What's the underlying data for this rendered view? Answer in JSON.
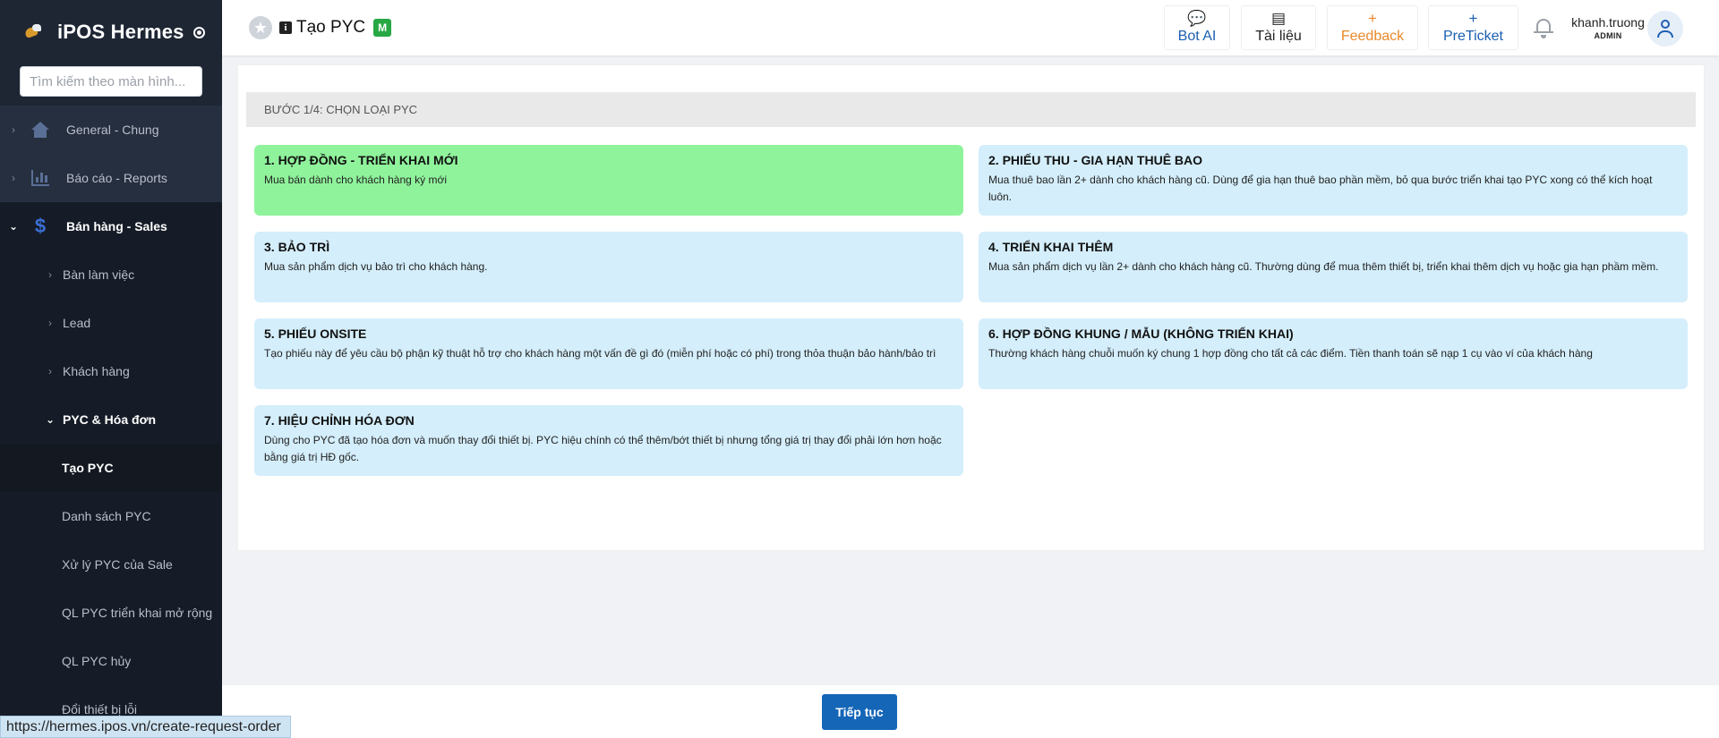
{
  "sidebar": {
    "brand": "iPOS Hermes",
    "search_placeholder": "Tìm kiếm theo màn hình...",
    "items": [
      {
        "label": "General - Chung",
        "icon": "home-icon"
      },
      {
        "label": "Báo cáo - Reports",
        "icon": "bar-chart-icon"
      },
      {
        "label": "Bán hàng - Sales",
        "icon": "dollar-icon"
      }
    ],
    "sub_items": [
      {
        "label": "Bàn làm việc"
      },
      {
        "label": "Lead"
      },
      {
        "label": "Khách hàng"
      },
      {
        "label": "PYC & Hóa đơn"
      }
    ],
    "sub_sub_items": [
      {
        "label": "Tạo PYC"
      },
      {
        "label": "Danh sách PYC"
      },
      {
        "label": "Xử lý PYC của Sale"
      },
      {
        "label": "QL PYC triển khai mở rộng"
      },
      {
        "label": "QL PYC hủy"
      },
      {
        "label": "Đổi thiết bị lỗi"
      }
    ]
  },
  "header": {
    "title": "Tạo PYC",
    "badge": "M",
    "buttons": [
      {
        "label": "Bot AI",
        "icon": "chat-icon",
        "color": "#1a5fb0"
      },
      {
        "label": "Tài liệu",
        "icon": "book-icon",
        "color": "#222222"
      },
      {
        "label": "Feedback",
        "icon": "plus-icon",
        "color": "#e8892a"
      },
      {
        "label": "PreTicket",
        "icon": "plus-icon",
        "color": "#1a5fb0"
      }
    ],
    "user": {
      "name": "khanh.truong",
      "role": "ADMIN"
    }
  },
  "main": {
    "step": "BƯỚC 1/4: CHỌN LOẠI PYC",
    "options": [
      {
        "title": "1. HỢP ĐỒNG - TRIỂN KHAI MỚI",
        "desc": "Mua bán dành cho khách hàng ký mới",
        "selected": true
      },
      {
        "title": "2. PHIẾU THU - GIA HẠN THUÊ BAO",
        "desc": "Mua thuê bao lần 2+ dành cho khách hàng cũ. Dùng để gia hạn thuê bao phần mềm, bỏ qua bước triển khai tạo PYC xong có thể kích hoạt luôn.",
        "selected": false
      },
      {
        "title": "3. BẢO TRÌ",
        "desc": "Mua sản phẩm dịch vụ bảo trì cho khách hàng.",
        "selected": false
      },
      {
        "title": "4. TRIỂN KHAI THÊM",
        "desc": "Mua sản phẩm dịch vụ lần 2+ dành cho khách hàng cũ. Thường dùng để mua thêm thiết bị, triển khai thêm dịch vụ hoặc gia hạn phầm mềm.",
        "selected": false
      },
      {
        "title": "5. PHIẾU ONSITE",
        "desc": "Tạo phiếu này để yêu cầu bộ phận kỹ thuật hỗ trợ cho khách hàng một vấn đề gì đó (miễn phí hoặc có phí) trong thỏa thuận bảo hành/bảo trì",
        "selected": false
      },
      {
        "title": "6. HỢP ĐỒNG KHUNG / MẪU (KHÔNG TRIỂN KHAI)",
        "desc": "Thường khách hàng chuỗi muốn ký chung 1 hợp đồng cho tất cả các điểm. Tiền thanh toán sẽ nạp 1 cụ vào ví của khách hàng",
        "selected": false
      },
      {
        "title": "7. HIỆU CHỈNH HÓA ĐƠN",
        "desc": "Dùng cho PYC đã tạo hóa đơn và muốn thay đổi thiết bị. PYC hiệu chính có thể thêm/bớt thiết bị nhưng tổng giá trị thay đổi phải lớn hơn hoặc bằng giá trị HĐ gốc.",
        "selected": false
      }
    ],
    "next_label": "Tiếp tục"
  },
  "status_url": "https://hermes.ipos.vn/create-request-order",
  "colors": {
    "selected": "#8ff39b",
    "option_bg": "#d4eefb",
    "primary": "#1566b7",
    "sidebar_bg": "#1e2634"
  }
}
